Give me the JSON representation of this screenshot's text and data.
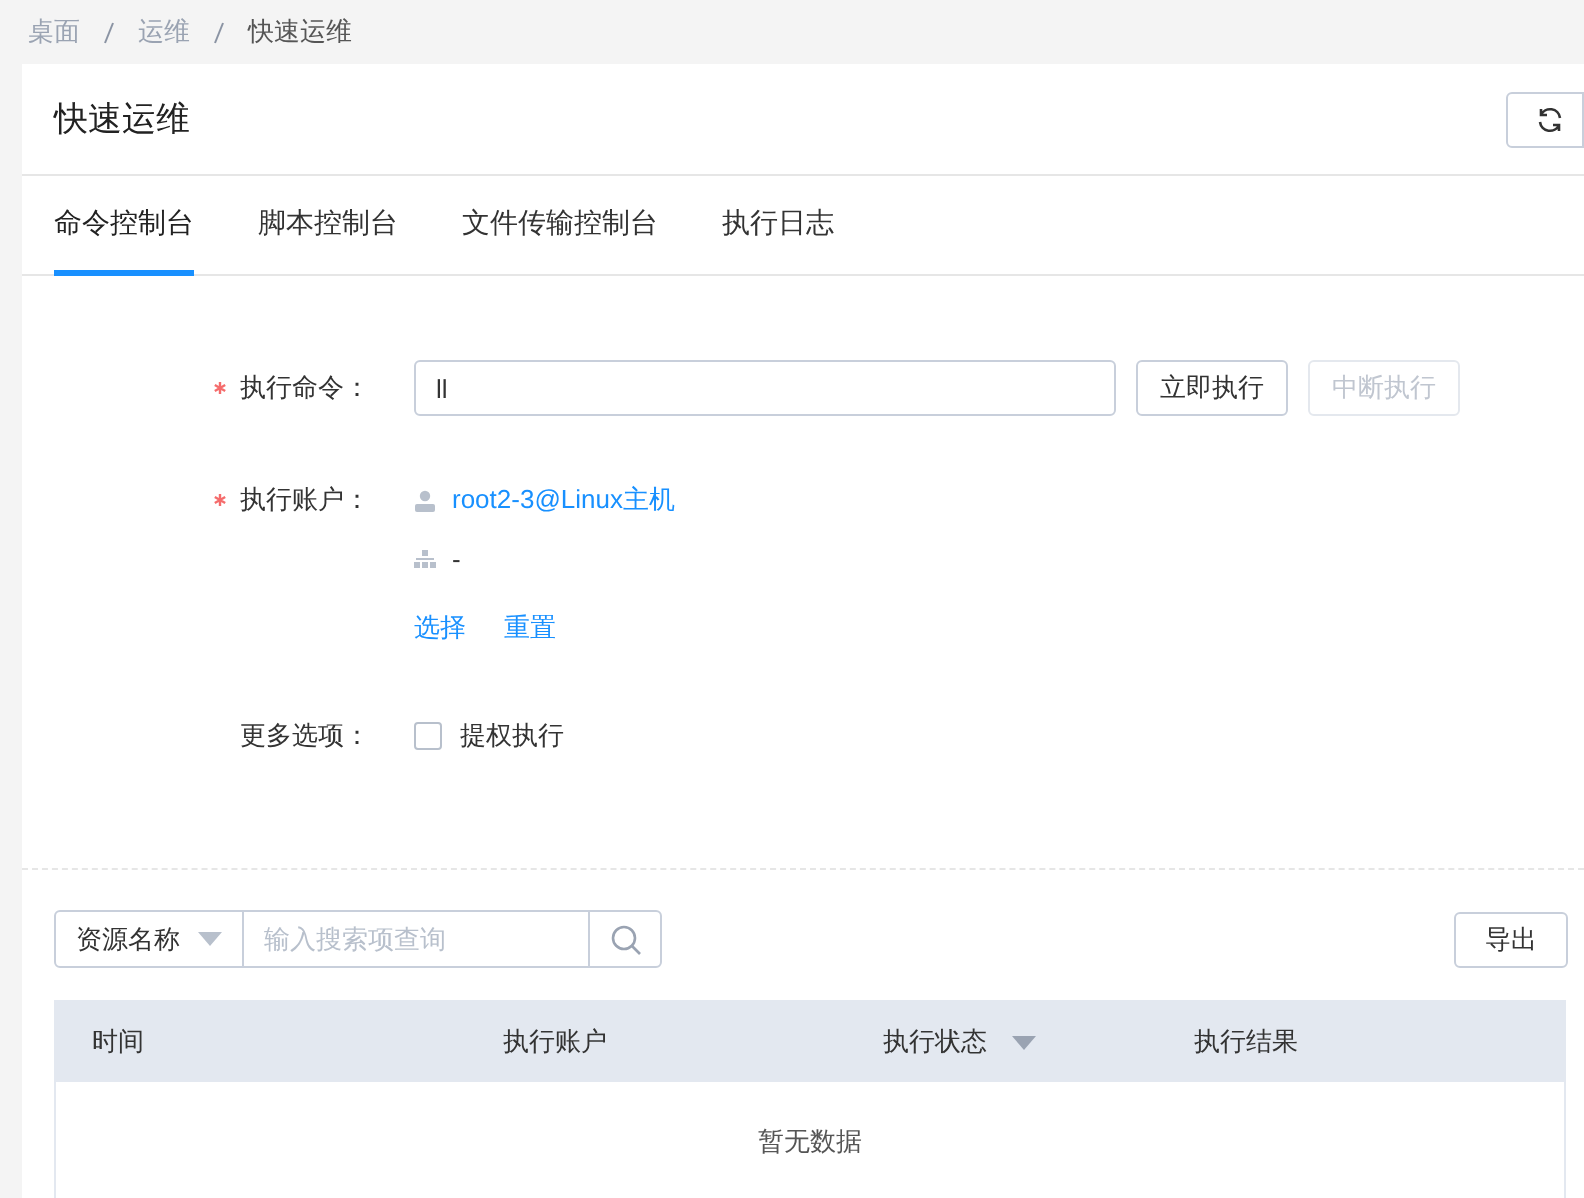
{
  "breadcrumb": [
    {
      "label": "桌面",
      "current": false
    },
    {
      "label": "运维",
      "current": false
    },
    {
      "label": "快速运维",
      "current": true
    }
  ],
  "page_title": "快速运维",
  "tabs": [
    {
      "label": "命令控制台",
      "selected": true
    },
    {
      "label": "脚本控制台",
      "selected": false
    },
    {
      "label": "文件传输控制台",
      "selected": false
    },
    {
      "label": "执行日志",
      "selected": false
    }
  ],
  "form": {
    "command": {
      "label": "执行命令：",
      "required": true,
      "value": "ll",
      "buttons": [
        {
          "label": "立即执行",
          "disabled": false
        },
        {
          "label": "中断执行",
          "disabled": true
        }
      ]
    },
    "account": {
      "label": "执行账户：",
      "required": true,
      "account": "root2-3@Linux主机",
      "group": "-",
      "links": [
        "选择",
        "重置"
      ]
    },
    "options": {
      "label": "更多选项：",
      "required": false,
      "checkbox": {
        "label": "提权执行",
        "checked": false
      }
    }
  },
  "toolbar": {
    "filter": "资源名称",
    "search_placeholder": "输入搜索项查询",
    "export": "导出"
  },
  "table": {
    "columns": [
      {
        "label": "时间",
        "filterable": false
      },
      {
        "label": "执行账户",
        "filterable": false
      },
      {
        "label": "执行状态",
        "filterable": true
      },
      {
        "label": "执行结果",
        "filterable": false
      }
    ],
    "empty_text": "暂无数据"
  }
}
